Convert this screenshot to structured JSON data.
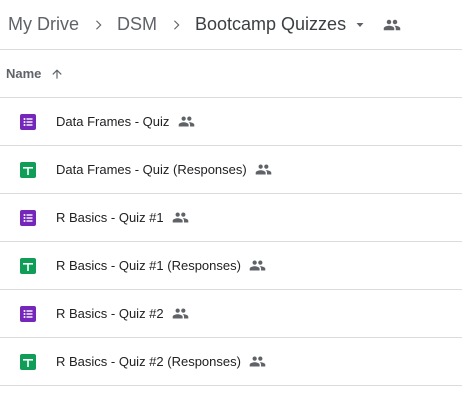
{
  "breadcrumb": {
    "items": [
      "My Drive",
      "DSM",
      "Bootcamp Quizzes"
    ]
  },
  "header": {
    "name_label": "Name"
  },
  "files": [
    {
      "name": "Data Frames - Quiz",
      "type": "google-forms",
      "shared": true
    },
    {
      "name": "Data Frames - Quiz (Responses)",
      "type": "google-sheets",
      "shared": true
    },
    {
      "name": "R Basics - Quiz #1",
      "type": "google-forms",
      "shared": true
    },
    {
      "name": "R Basics - Quiz #1 (Responses)",
      "type": "google-sheets",
      "shared": true
    },
    {
      "name": "R Basics - Quiz #2",
      "type": "google-forms",
      "shared": true
    },
    {
      "name": "R Basics - Quiz #2 (Responses)",
      "type": "google-sheets",
      "shared": true
    }
  ],
  "colors": {
    "forms": "#7627bb",
    "sheets": "#0f9d58",
    "icon_gray": "#5f6368",
    "divider": "#dadce0"
  }
}
